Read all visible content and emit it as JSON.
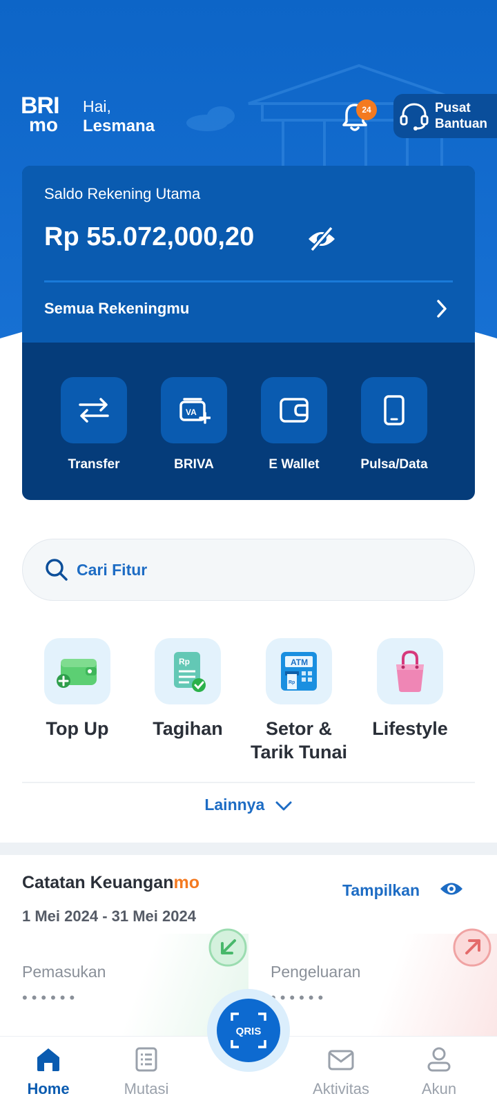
{
  "header": {
    "brand_top": "BRI",
    "brand_bottom": "mo",
    "greeting": "Hai,",
    "user_name": "Lesmana",
    "notification_count": "24",
    "help_line1": "Pusat",
    "help_line2": "Bantuan"
  },
  "balance_card": {
    "label": "Saldo Rekening Utama",
    "amount": "Rp 55.072,000,20",
    "all_accounts": "Semua Rekeningmu"
  },
  "quick_actions": [
    {
      "label": "Transfer",
      "icon": "transfer-icon"
    },
    {
      "label": "BRIVA",
      "icon": "briva-icon"
    },
    {
      "label": "E Wallet",
      "icon": "wallet-icon"
    },
    {
      "label": "Pulsa/Data",
      "icon": "phone-icon"
    }
  ],
  "search": {
    "placeholder": "Cari Fitur"
  },
  "features": [
    {
      "label": "Top Up",
      "icon": "topup-wallet-icon"
    },
    {
      "label": "Tagihan",
      "icon": "bill-icon"
    },
    {
      "label": "Setor & Tarik Tunai",
      "icon": "atm-icon"
    },
    {
      "label": "Lifestyle",
      "icon": "shopping-bag-icon"
    }
  ],
  "more_label": "Lainnya",
  "finance": {
    "title": "Catatan Keuangan",
    "title_suffix": "mo",
    "show_label": "Tampilkan",
    "range": "1 Mei 2024 - 31 Mei 2024",
    "income_label": "Pemasukan",
    "income_value": "••••••",
    "expense_label": "Pengeluaran",
    "expense_value": "••••••"
  },
  "nav": {
    "home": "Home",
    "mutasi": "Mutasi",
    "qris": "QRIS",
    "aktivitas": "Aktivitas",
    "akun": "Akun"
  },
  "colors": {
    "primary": "#0a5bb0",
    "card_dark": "#053c7a",
    "accent_orange": "#f47a20",
    "income_green": "#48b86b",
    "expense_red": "#e46a6a"
  }
}
